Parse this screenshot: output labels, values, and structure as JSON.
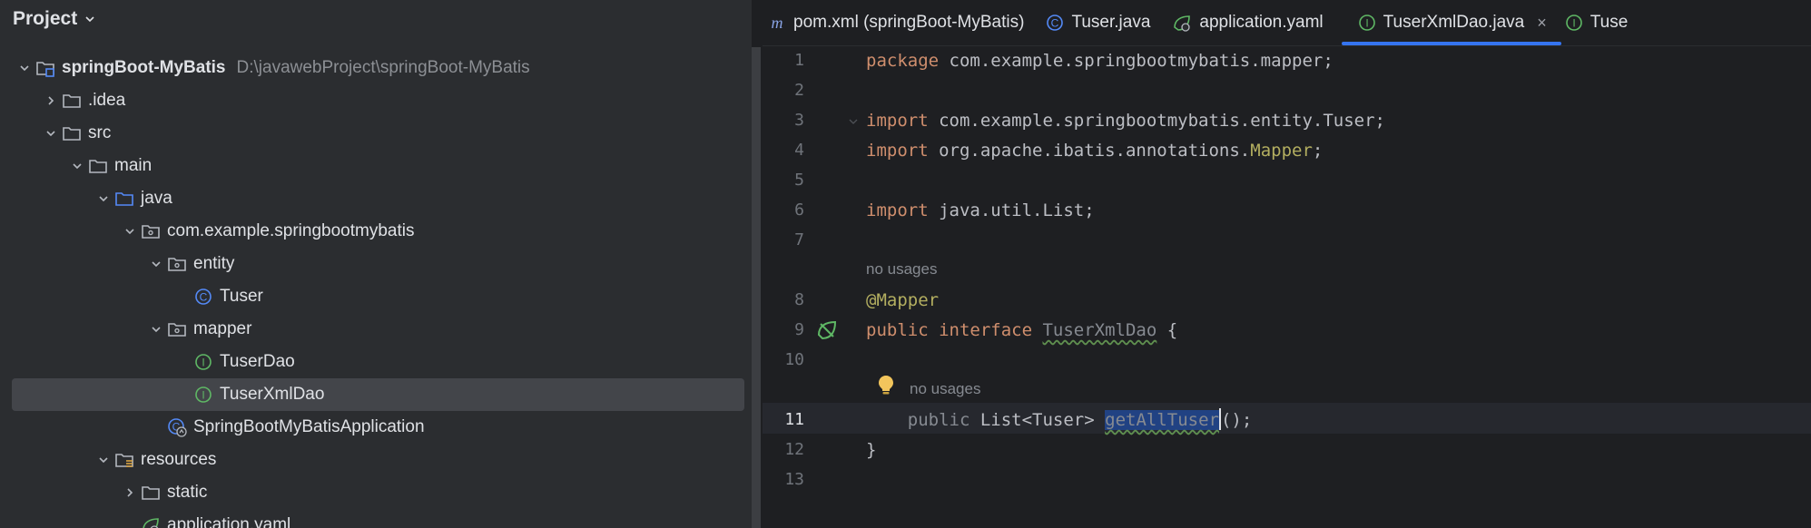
{
  "project_panel": {
    "title": "Project",
    "tree": [
      {
        "label": "springBoot-MyBatis",
        "path": "D:\\javawebProject\\springBoot-MyBatis",
        "icon": "module-folder-icon",
        "depth": 0,
        "toggle": "expanded"
      },
      {
        "label": ".idea",
        "icon": "folder-icon",
        "depth": 1,
        "toggle": "collapsed"
      },
      {
        "label": "src",
        "icon": "folder-icon",
        "depth": 1,
        "toggle": "expanded"
      },
      {
        "label": "main",
        "icon": "folder-icon",
        "depth": 2,
        "toggle": "expanded"
      },
      {
        "label": "java",
        "icon": "source-folder-icon",
        "depth": 3,
        "toggle": "expanded"
      },
      {
        "label": "com.example.springbootmybatis",
        "icon": "package-icon",
        "depth": 4,
        "toggle": "expanded"
      },
      {
        "label": "entity",
        "icon": "package-icon",
        "depth": 5,
        "toggle": "expanded"
      },
      {
        "label": "Tuser",
        "icon": "class-icon",
        "depth": 6,
        "toggle": "none"
      },
      {
        "label": "mapper",
        "icon": "package-icon",
        "depth": 5,
        "toggle": "expanded"
      },
      {
        "label": "TuserDao",
        "icon": "interface-icon",
        "depth": 6,
        "toggle": "none"
      },
      {
        "label": "TuserXmlDao",
        "icon": "interface-icon",
        "depth": 6,
        "toggle": "none",
        "selected": true
      },
      {
        "label": "SpringBootMyBatisApplication",
        "icon": "spring-class-icon",
        "depth": 5,
        "toggle": "none"
      },
      {
        "label": "resources",
        "icon": "resources-folder-icon",
        "depth": 3,
        "toggle": "expanded"
      },
      {
        "label": "static",
        "icon": "folder-icon",
        "depth": 4,
        "toggle": "collapsed"
      },
      {
        "label": "application.yaml",
        "icon": "yaml-icon",
        "depth": 4,
        "toggle": "none"
      }
    ]
  },
  "tabs": [
    {
      "label": "pom.xml (springBoot-MyBatis)",
      "icon": "maven-icon"
    },
    {
      "label": "Tuser.java",
      "icon": "class-icon"
    },
    {
      "label": "application.yaml",
      "icon": "yaml-icon"
    },
    {
      "label": "TuserXmlDao.java",
      "icon": "interface-icon",
      "active": true,
      "close": "×"
    },
    {
      "label": "Tuse",
      "icon": "interface-icon"
    }
  ],
  "editor": {
    "line_numbers": [
      "1",
      "2",
      "3",
      "4",
      "5",
      "6",
      "7",
      "8",
      "9",
      "10",
      "11",
      "12",
      "13"
    ],
    "current_line": "11",
    "hint_no_usages": "no usages",
    "code": {
      "l1_kw": "package",
      "l1_rest": " com.example.springbootmybatis.mapper;",
      "l3_kw": "import",
      "l3_rest": " com.example.springbootmybatis.entity.Tuser;",
      "l4_kw": "import",
      "l4_pkg": " org.apache.ibatis.annotations.",
      "l4_ann": "Mapper",
      "l4_end": ";",
      "l6_kw": "import",
      "l6_rest": " java.util.List;",
      "l8_ann": "@Mapper",
      "l9_kw1": "public",
      "l9_kw2": " interface ",
      "l9_name": "TuserXmlDao",
      "l9_end": " {",
      "l11_mod": "    public ",
      "l11_type": "List<Tuser> ",
      "l11_method": "getAllTuser",
      "l11_end": "();",
      "l12": "}"
    }
  }
}
